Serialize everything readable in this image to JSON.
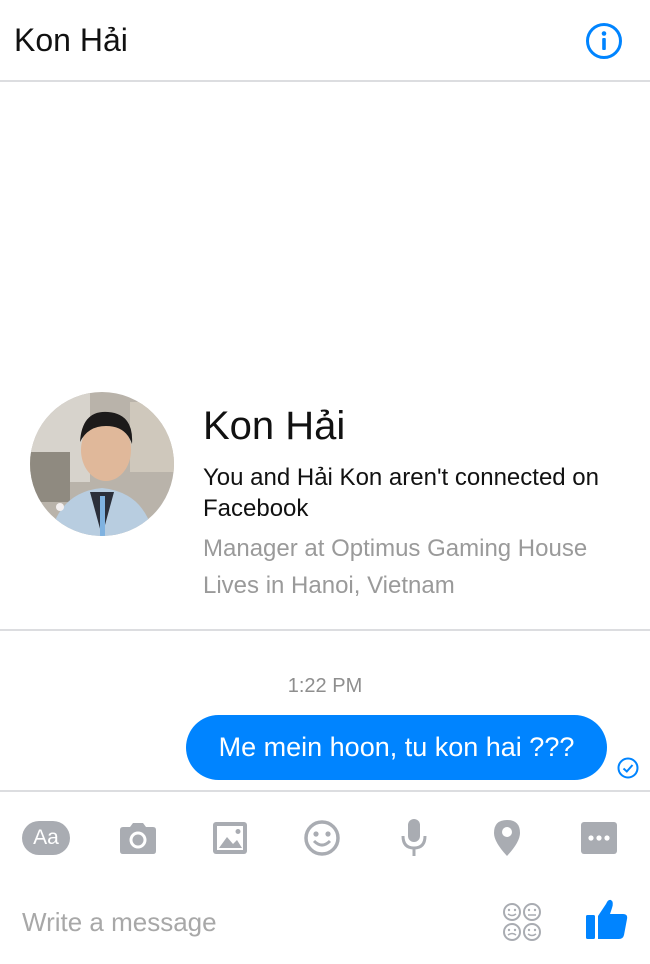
{
  "header": {
    "title": "Kon Hải",
    "info_icon": "info-icon"
  },
  "profile": {
    "name": "Kon Hải",
    "connection_text": "You and Hải Kon aren't connected on Facebook",
    "work": "Manager at Optimus Gaming House",
    "lives": "Lives in Hanoi, Vietnam",
    "avatar_icon": "profile-photo"
  },
  "conversation": {
    "timestamp": "1:22 PM",
    "messages": [
      {
        "sender": "me",
        "text": "Me mein hoon, tu kon hai ???",
        "status_icon": "sent-check-icon"
      }
    ]
  },
  "toolbar": {
    "items": [
      {
        "name": "text-style-button",
        "label": "Aa",
        "icon": "aa-icon"
      },
      {
        "name": "camera-button",
        "icon": "camera-icon"
      },
      {
        "name": "gallery-button",
        "icon": "image-icon"
      },
      {
        "name": "emoji-button",
        "icon": "smiley-icon"
      },
      {
        "name": "voice-button",
        "icon": "microphone-icon"
      },
      {
        "name": "location-button",
        "icon": "location-pin-icon"
      },
      {
        "name": "more-button",
        "icon": "more-icon"
      }
    ]
  },
  "composer": {
    "placeholder": "Write a message",
    "sticker_icon": "stickers-icon",
    "like_icon": "thumbs-up-icon"
  },
  "colors": {
    "accent": "#0084ff",
    "toolbar_icon": "#a9acb2",
    "secondary_text": "#9a9a9a",
    "divider": "#dcdde0"
  }
}
